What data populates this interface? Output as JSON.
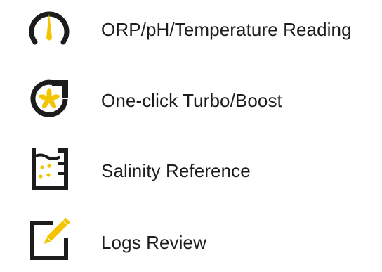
{
  "colors": {
    "ink": "#1c1c1c",
    "accent": "#f2c500"
  },
  "features": [
    {
      "icon": "gauge-icon",
      "label": "ORP/pH/Temperature Reading"
    },
    {
      "icon": "turbo-fan-icon",
      "label": "One-click Turbo/Boost"
    },
    {
      "icon": "salinity-beaker-icon",
      "label": "Salinity Reference"
    },
    {
      "icon": "edit-log-icon",
      "label": "Logs Review"
    }
  ]
}
